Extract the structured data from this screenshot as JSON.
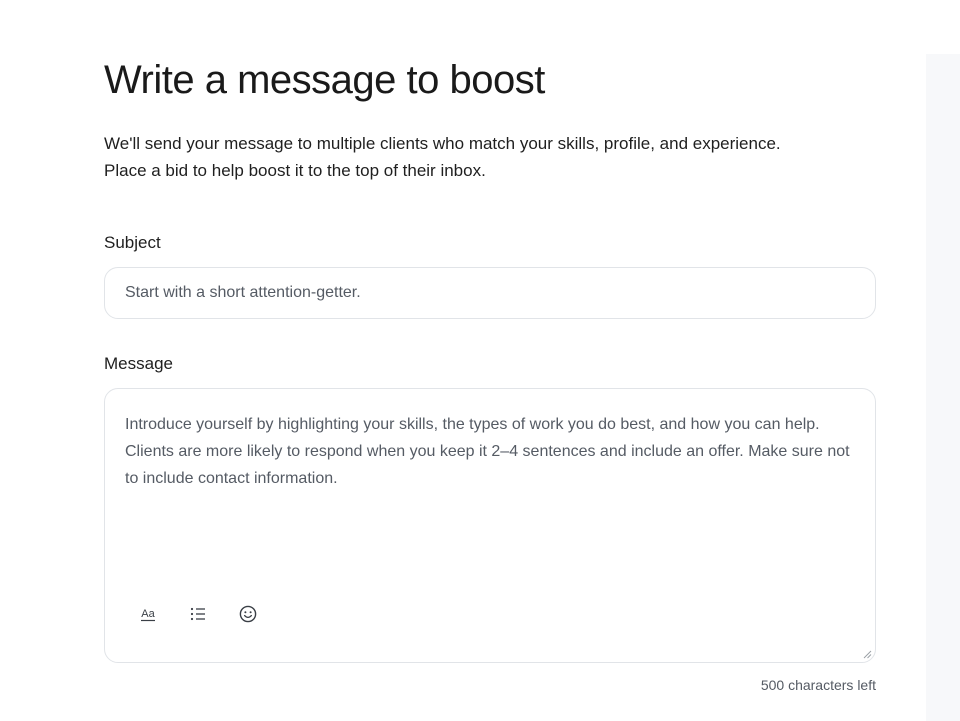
{
  "page": {
    "title": "Write a message to boost",
    "description_line1": "We'll send your message to multiple clients who match your skills, profile, and experience.",
    "description_line2": "Place a bid to help boost it to the top of their inbox."
  },
  "subject": {
    "label": "Subject",
    "value": "",
    "placeholder": "Start with a short attention-getter."
  },
  "message": {
    "label": "Message",
    "value": "",
    "placeholder": "Introduce yourself by highlighting your skills, the types of work you do best, and how you can help. Clients are more likely to respond when you keep it 2–4 sentences and include an offer. Make sure not to include contact information.",
    "toolbar": [
      {
        "name": "text-format",
        "icon": "text-format-icon",
        "glyph": "Aa"
      },
      {
        "name": "bulleted-list",
        "icon": "bulleted-list-icon"
      },
      {
        "name": "emoji",
        "icon": "emoji-icon"
      }
    ]
  },
  "char_count": "500 characters left",
  "colors": {
    "text": "#1f1f1f",
    "placeholder": "#555b64",
    "border": "#e1e4e8",
    "side_panel": "#f7f8fa"
  }
}
